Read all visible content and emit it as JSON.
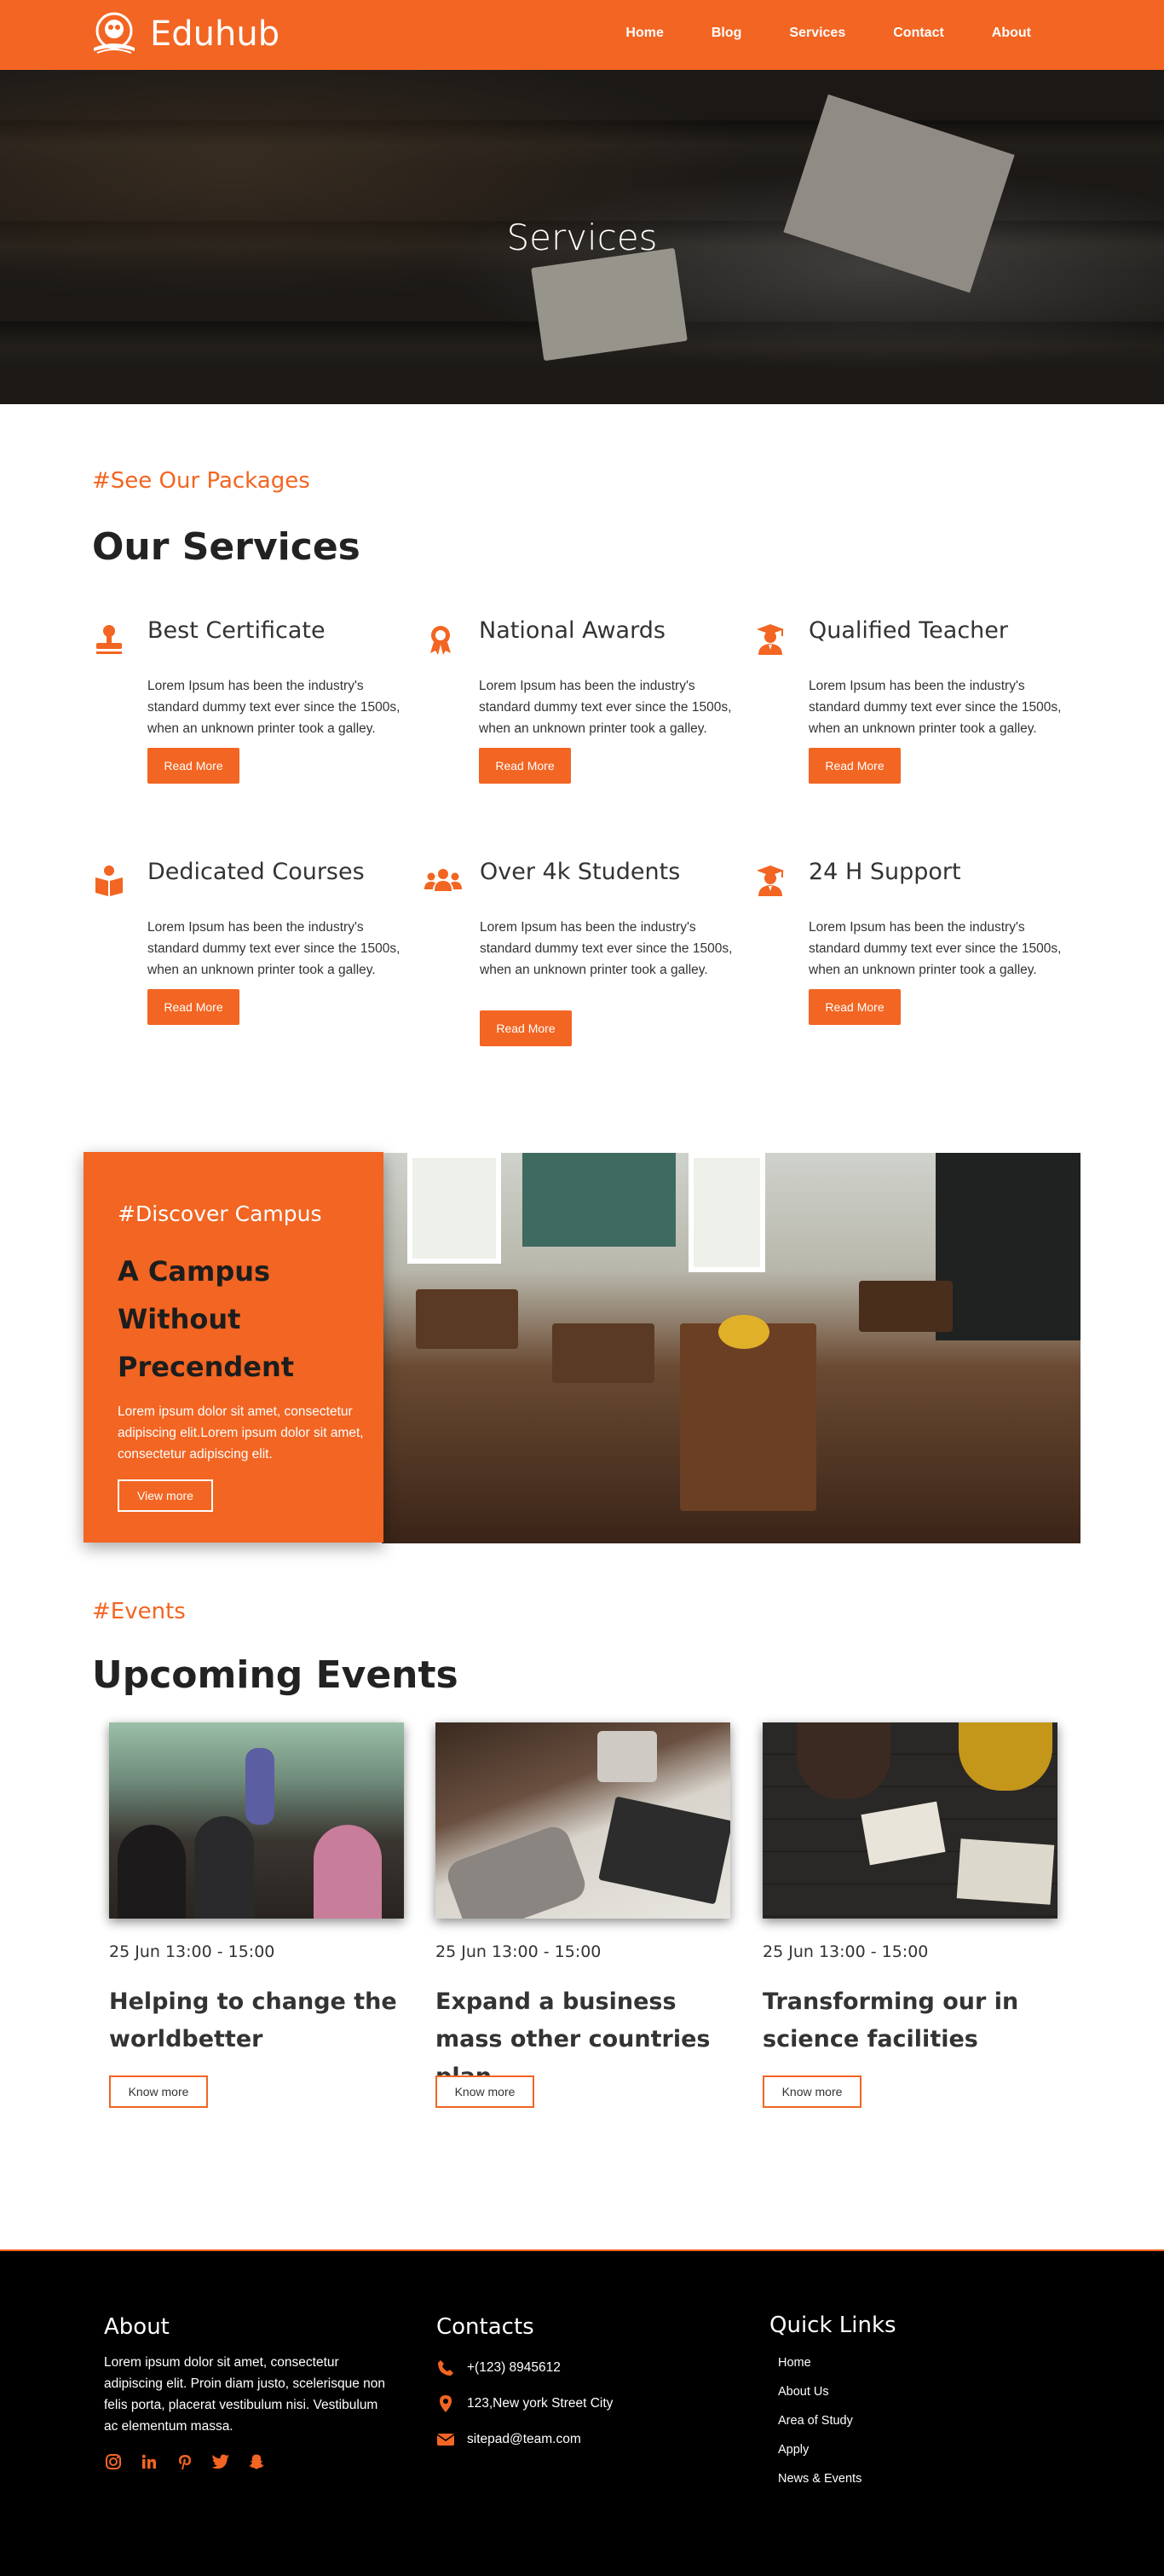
{
  "brand": {
    "name": "Eduhub",
    "logo": "graduation-owl-logo"
  },
  "nav": [
    "Home",
    "Blog",
    "Services",
    "Contact",
    "About"
  ],
  "hero": {
    "title": "Services"
  },
  "services": {
    "eyebrow": "#See Our Packages",
    "title": "Our Services",
    "items": [
      {
        "title": "Best Certificate",
        "icon": "stamp-icon",
        "text": "Lorem Ipsum has been the industry's standard dummy text ever since the 1500s, when an unknown printer took a galley.",
        "button": "Read More"
      },
      {
        "title": "National Awards",
        "icon": "award-icon",
        "text": "Lorem Ipsum has been the industry's standard dummy text ever since the 1500s, when an unknown printer took a galley.",
        "button": "Read More"
      },
      {
        "title": "Qualified Teacher",
        "icon": "teacher-icon",
        "text": "Lorem Ipsum has been the industry's standard dummy text ever since the 1500s, when an unknown printer took a galley.",
        "button": "Read More"
      },
      {
        "title": "Dedicated Courses",
        "icon": "book-reader-icon",
        "text": "Lorem Ipsum has been the industry's standard dummy text ever since the 1500s, when an unknown printer took a galley.",
        "button": "Read More"
      },
      {
        "title": "Over 4k Students",
        "icon": "students-icon",
        "text": "Lorem Ipsum has been the industry's standard dummy text ever since the 1500s, when an unknown printer took a galley.",
        "button": "Read More"
      },
      {
        "title": "24 H Support",
        "icon": "support-teacher-icon",
        "text": "Lorem Ipsum has been the industry's standard dummy text ever since the 1500s, when an unknown printer took a galley.",
        "button": "Read More"
      }
    ]
  },
  "campus": {
    "eyebrow": "#Discover Campus",
    "title": "A Campus Without Precendent",
    "text": "Lorem ipsum dolor sit amet, consectetur adipiscing elit.Lorem ipsum dolor sit amet, consectetur adipiscing elit.",
    "button": "View more"
  },
  "events": {
    "eyebrow": "#Events",
    "title": "Upcoming Events",
    "items": [
      {
        "date": "25 Jun 13:00 - 15:00",
        "title": "Helping to change the worldbetter",
        "button": "Know more"
      },
      {
        "date": "25 Jun 13:00 - 15:00",
        "title": "Expand a business mass other countries plan",
        "button": "Know more"
      },
      {
        "date": "25 Jun 13:00 - 15:00",
        "title": "Transforming our in science facilities",
        "button": "Know more"
      }
    ]
  },
  "footer": {
    "about": {
      "title": "About",
      "text": "Lorem ipsum dolor sit amet, consectetur adipiscing elit. Proin diam justo, scelerisque non felis porta, placerat vestibulum nisi. Vestibulum ac elementum massa.",
      "social": [
        "instagram-icon",
        "linkedin-icon",
        "pinterest-icon",
        "twitter-icon",
        "snapchat-icon"
      ]
    },
    "contacts": {
      "title": "Contacts",
      "phone": "+(123) 8945612",
      "address": "123,New york Street City",
      "email": "sitepad@team.com"
    },
    "links": {
      "title": "Quick Links",
      "items": [
        "Home",
        "About Us",
        "Area of Study",
        "Apply",
        "News & Events"
      ]
    }
  },
  "colors": {
    "accent": "#f26522",
    "footer_bg": "#000000"
  }
}
